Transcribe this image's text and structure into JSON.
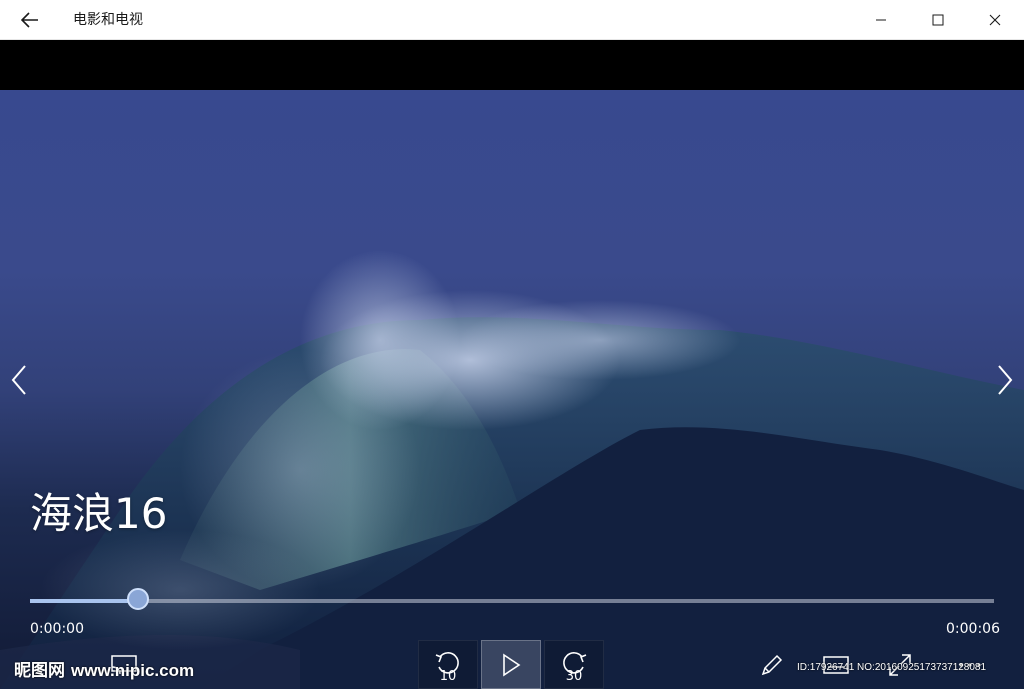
{
  "window": {
    "title": "电影和电视",
    "back_icon": "back-arrow-icon",
    "minimize_icon": "minimize-icon",
    "maximize_icon": "maximize-icon",
    "close_icon": "close-icon"
  },
  "video": {
    "title": "海浪16",
    "current_time": "0:00:00",
    "duration": "0:00:06",
    "progress_fraction": 0.112
  },
  "controls": {
    "rewind_seconds": "10",
    "forward_seconds": "30",
    "play_icon": "play-icon",
    "rewind_icon": "rewind-icon",
    "forward_icon": "forward-icon",
    "cast_icon": "cast-icon",
    "edit_icon": "pencil-icon",
    "caption_icon": "caption-icon",
    "fullscreen_icon": "fullscreen-icon",
    "more_icon": "more-icon",
    "prev_icon": "chevron-left-icon",
    "next_icon": "chevron-right-icon"
  },
  "watermark": {
    "brand": "昵图网",
    "url": "www.nipic.com",
    "id_text": "ID:17926741 NO:20160925173737128081"
  },
  "colors": {
    "titlebar_bg": "#ffffff",
    "progress_fill": "#a9c4ee",
    "progress_track": "#8c93a8"
  }
}
